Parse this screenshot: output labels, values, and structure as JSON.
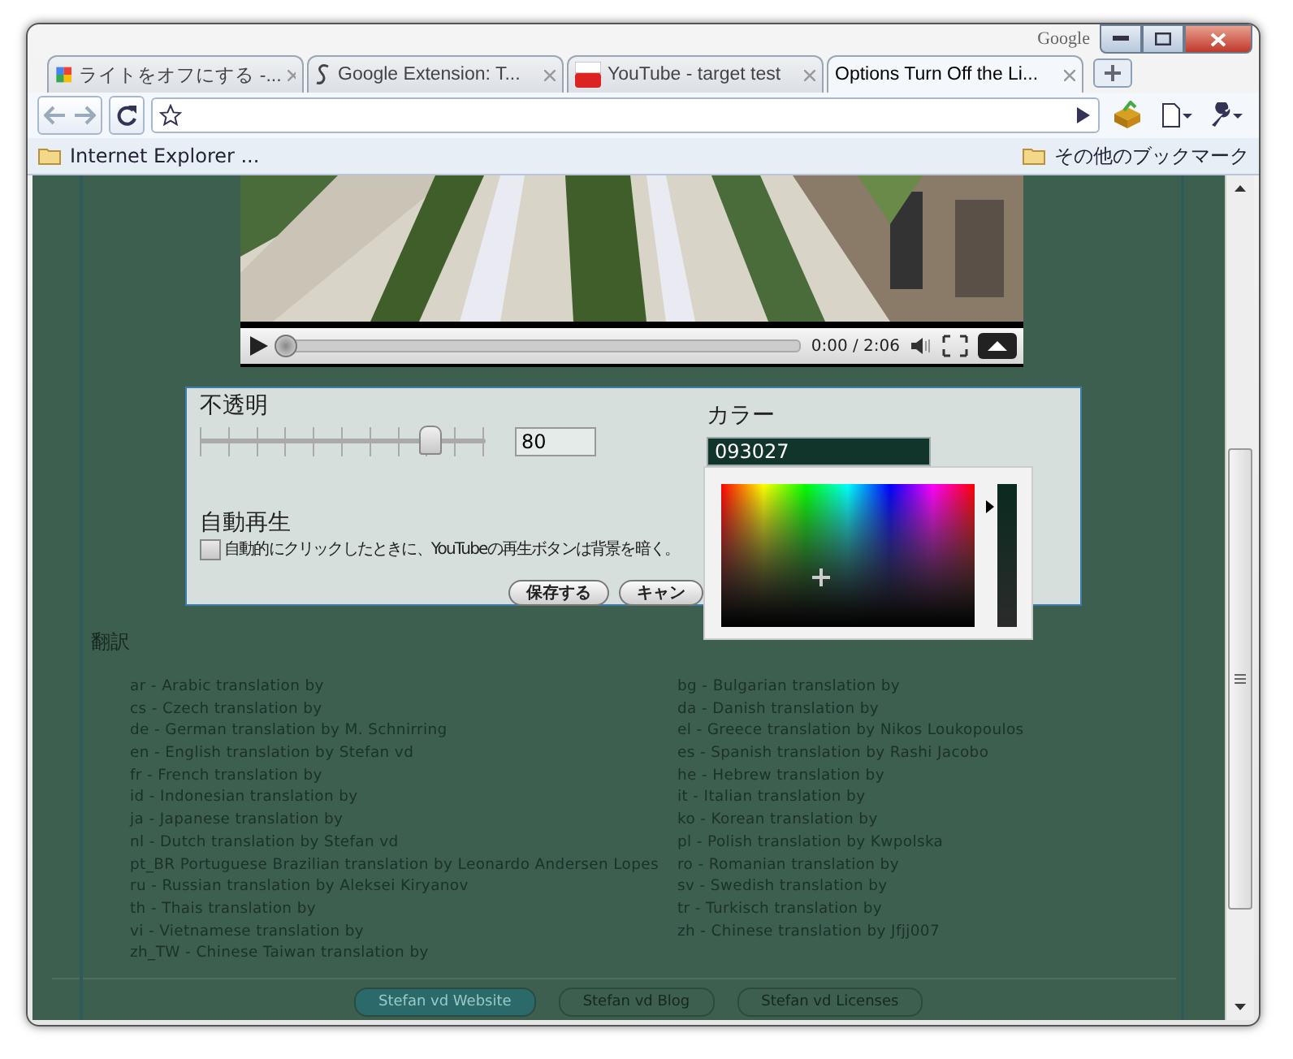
{
  "window": {
    "brand": "Google"
  },
  "tabs": [
    {
      "label": "ライトをオフにする -...",
      "selected": false
    },
    {
      "label": "Google Extension: T...",
      "selected": false
    },
    {
      "label": "YouTube - target test",
      "selected": false
    },
    {
      "label": "Options Turn Off the Li...",
      "selected": true
    }
  ],
  "bookmarks": {
    "left": "Internet Explorer ...",
    "right": "その他のブックマーク"
  },
  "video": {
    "time": "0:00 / 2:06",
    "progress": {
      "level": 0
    }
  },
  "options": {
    "opacity_label": "不透明",
    "opacity": {
      "level": 0.8,
      "value": "80"
    },
    "color_label": "カラー",
    "color_value": "093027",
    "autoplay_heading": "自動再生",
    "autoplay": {
      "label": "自動的にクリックしたときに、YouTubeの再生ボタンは背景を暗く。",
      "checked": false
    },
    "buttons": [
      "保存する",
      "キャン"
    ]
  },
  "translations": {
    "heading": "翻訳",
    "left": [
      "ar - Arabic translation by",
      "cs - Czech translation by",
      "de - German translation by M. Schnirring",
      "en - English translation by Stefan vd",
      "fr - French translation by",
      "id - Indonesian translation by",
      "ja - Japanese translation by",
      "nl - Dutch translation by Stefan vd",
      "pt_BR  Portuguese Brazilian translation by Leonardo Andersen Lopes",
      "ru - Russian translation by Aleksei Kiryanov",
      "th - Thais translation by",
      "vi - Vietnamese translation by",
      "zh_TW - Chinese Taiwan translation by"
    ],
    "right": [
      "bg - Bulgarian translation by",
      "da - Danish translation by",
      "el - Greece translation by Nikos Loukopoulos",
      "es - Spanish translation by Rashi Jacobo",
      "he - Hebrew translation by",
      "it - Italian translation by",
      "ko - Korean translation by",
      "pl - Polish translation by Kwpolska",
      "ro - Romanian translation by",
      "sv - Swedish translation by",
      "tr - Turkisch translation by",
      "zh - Chinese translation by Jfjj007"
    ]
  },
  "footer_links": [
    {
      "label": "Stefan vd Website",
      "selected": true
    },
    {
      "label": "Stefan vd Blog",
      "selected": false
    },
    {
      "label": "Stefan vd Licenses",
      "selected": false
    }
  ]
}
